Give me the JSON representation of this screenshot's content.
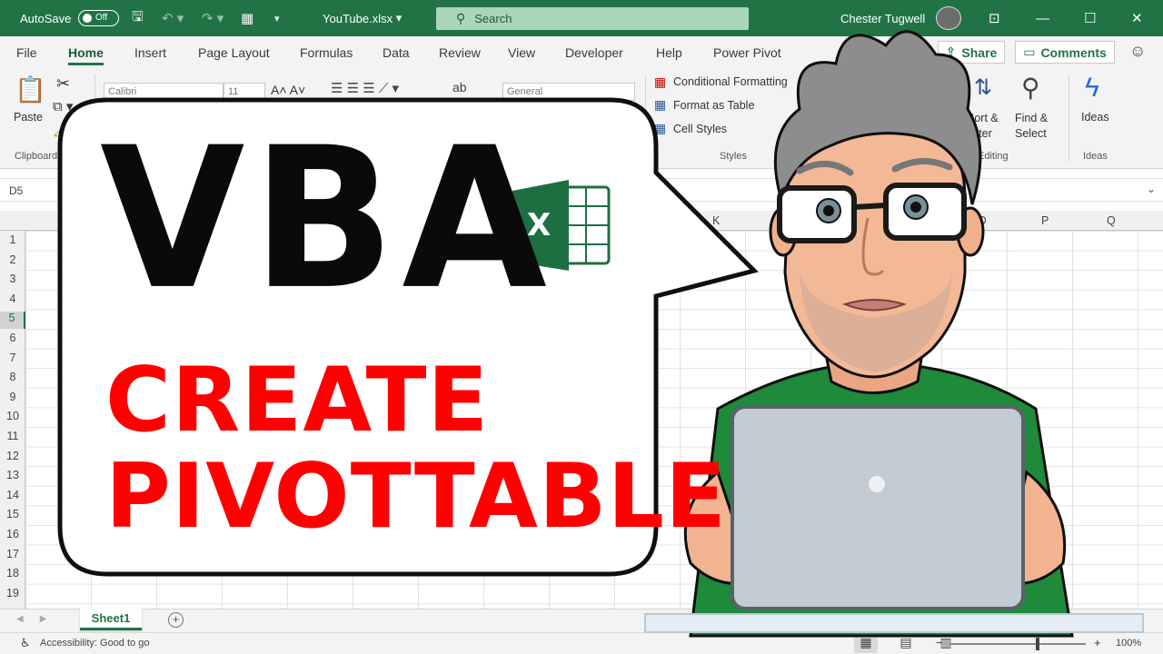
{
  "titlebar": {
    "autosave_label": "AutoSave",
    "autosave_state": "Off",
    "filename": "YouTube.xlsx",
    "filename_caret": "▾",
    "search_placeholder": "Search",
    "username": "Chester Tugwell",
    "bg_color": "#217346"
  },
  "tabs": [
    "File",
    "Home",
    "Insert",
    "Page Layout",
    "Formulas",
    "Data",
    "Review",
    "View",
    "Developer",
    "Help",
    "Power Pivot"
  ],
  "active_tab": "Home",
  "share_label": "Share",
  "comments_label": "Comments",
  "ribbon": {
    "paste_label": "Paste",
    "clipboard_group": "Clipboard",
    "font_name": "Calibri",
    "font_size": "11",
    "number_format": "General",
    "conditional_formatting": "Conditional Formatting",
    "format_as_table": "Format as Table",
    "cell_styles": "Cell Styles",
    "styles_group": "Styles",
    "sort_filter": "Sort & Filter",
    "find_select": "Find & Select",
    "editing_group": "Editing",
    "ideas_label": "Ideas",
    "ideas_group": "Ideas"
  },
  "formula_bar": {
    "name_box": "D5"
  },
  "columns": [
    "K",
    "O",
    "P",
    "Q"
  ],
  "rows": [
    "1",
    "2",
    "3",
    "4",
    "5",
    "6",
    "7",
    "8",
    "9",
    "10",
    "11",
    "12",
    "13",
    "14",
    "15",
    "16",
    "17",
    "18",
    "19"
  ],
  "selected_row": "5",
  "sheet_tab": "Sheet1",
  "status": {
    "accessibility": "Accessibility: Good to go",
    "zoom": "100%"
  },
  "thumbnail": {
    "headline": "VBA",
    "line1": "CREATE",
    "line2": "PIVOTTABLE",
    "excel_logo_letter": "X",
    "headline_color": "#0a0a0a",
    "accent_color": "#ff0000",
    "excel_green": "#1d6f42"
  }
}
